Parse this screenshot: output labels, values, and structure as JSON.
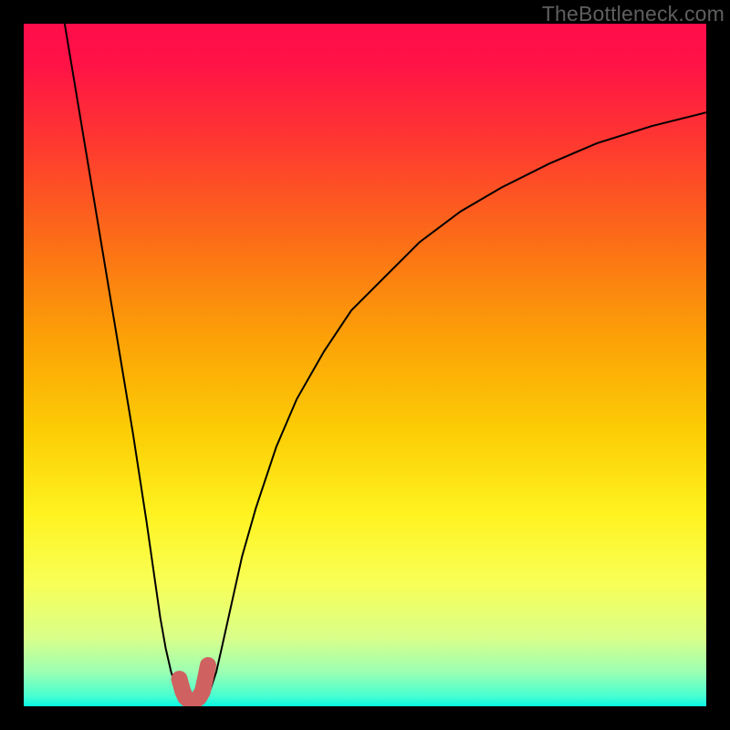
{
  "watermark": "TheBottleneck.com",
  "colors": {
    "background": "#000000",
    "gradient_stops": [
      {
        "offset": 0.0,
        "color": "#ff0d4b"
      },
      {
        "offset": 0.06,
        "color": "#ff1346"
      },
      {
        "offset": 0.18,
        "color": "#fe3a2f"
      },
      {
        "offset": 0.32,
        "color": "#fc6e17"
      },
      {
        "offset": 0.46,
        "color": "#fca107"
      },
      {
        "offset": 0.6,
        "color": "#fcce05"
      },
      {
        "offset": 0.72,
        "color": "#fff321"
      },
      {
        "offset": 0.82,
        "color": "#f8ff57"
      },
      {
        "offset": 0.9,
        "color": "#d9ff8a"
      },
      {
        "offset": 0.95,
        "color": "#9bffb3"
      },
      {
        "offset": 0.985,
        "color": "#48ffd1"
      },
      {
        "offset": 1.0,
        "color": "#08f6e4"
      }
    ],
    "curve": "#000000",
    "marker_fill": "#cf6161",
    "marker_stroke": "#cf6161"
  },
  "chart_data": {
    "type": "line",
    "title": "",
    "xlabel": "",
    "ylabel": "",
    "xlim": [
      0,
      100
    ],
    "ylim": [
      0,
      100
    ],
    "series": [
      {
        "name": "left-branch",
        "x": [
          6,
          8,
          10,
          12,
          14,
          16,
          18,
          19,
          20,
          20.8,
          21.6,
          22.4,
          23.2
        ],
        "y": [
          100,
          88,
          76,
          64,
          52,
          40,
          27,
          20,
          13,
          8.5,
          5,
          2.6,
          1.4
        ]
      },
      {
        "name": "right-branch",
        "x": [
          26.6,
          27.4,
          28.2,
          29,
          30,
          32,
          34,
          37,
          40,
          44,
          48,
          53,
          58,
          64,
          70,
          77,
          84,
          92,
          100
        ],
        "y": [
          1.4,
          2.6,
          5,
          8.5,
          13,
          22,
          29,
          38,
          45,
          52,
          58,
          63,
          68,
          72.5,
          76,
          79.5,
          82.5,
          85,
          87
        ]
      },
      {
        "name": "floor",
        "x": [
          23.2,
          23.8,
          24.4,
          25.0,
          25.6,
          26.2,
          26.6
        ],
        "y": [
          1.4,
          0.9,
          0.65,
          0.6,
          0.65,
          0.9,
          1.4
        ]
      }
    ],
    "markers": {
      "name": "highlight-u",
      "x": [
        22.8,
        23.3,
        23.7,
        24.2,
        24.7,
        25.2,
        25.7,
        26.2,
        26.6,
        27.0
      ],
      "y": [
        4.0,
        2.2,
        1.3,
        0.9,
        0.8,
        0.9,
        1.3,
        2.2,
        4.0,
        6.0
      ]
    }
  }
}
